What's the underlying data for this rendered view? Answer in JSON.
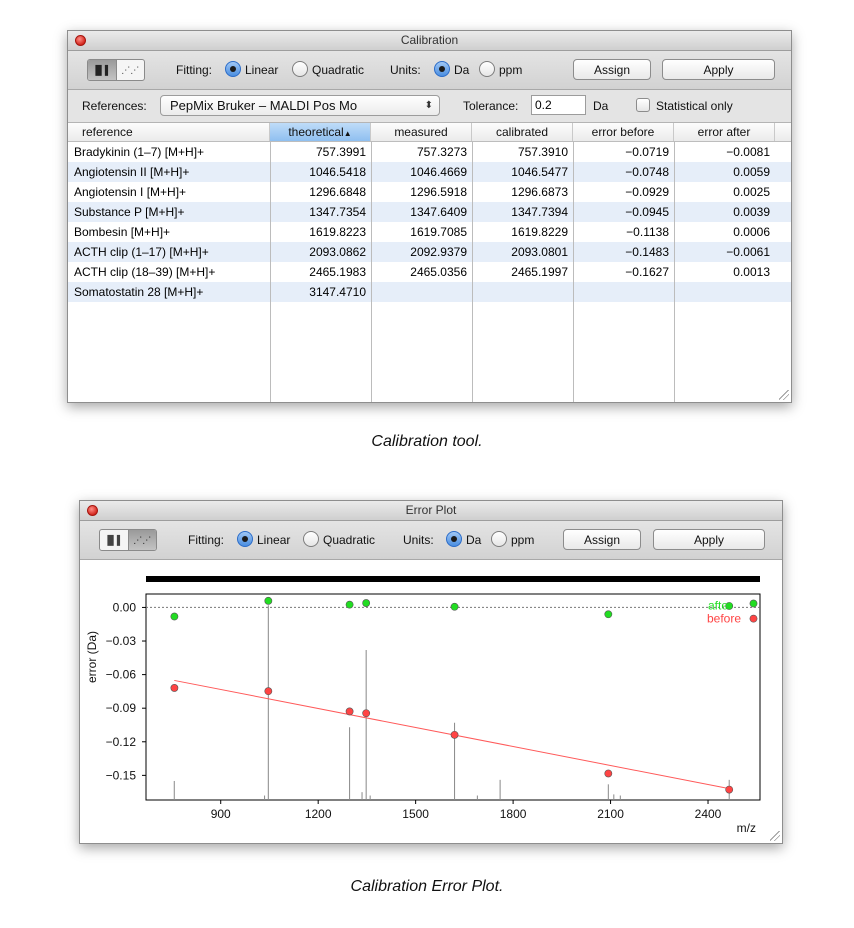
{
  "calibration_window": {
    "title": "Calibration",
    "toolbar": {
      "fitting_label": "Fitting:",
      "fitting_options": [
        "Linear",
        "Quadratic"
      ],
      "fitting_selected": "Linear",
      "units_label": "Units:",
      "units_options": [
        "Da",
        "ppm"
      ],
      "units_selected": "Da",
      "assign_label": "Assign",
      "apply_label": "Apply"
    },
    "references_bar": {
      "references_label": "References:",
      "references_value": "PepMix Bruker – MALDI Pos Mo",
      "tolerance_label": "Tolerance:",
      "tolerance_value": "0.2",
      "tolerance_unit": "Da",
      "statistical_only_label": "Statistical only"
    },
    "table": {
      "columns": [
        "reference",
        "theoretical",
        "measured",
        "calibrated",
        "error before",
        "error after"
      ],
      "sorted_column": "theoretical",
      "rows": [
        [
          "Bradykinin (1–7) [M+H]+",
          "757.3991",
          "757.3273",
          "757.3910",
          "−0.0719",
          "−0.0081"
        ],
        [
          "Angiotensin II [M+H]+",
          "1046.5418",
          "1046.4669",
          "1046.5477",
          "−0.0748",
          "0.0059"
        ],
        [
          "Angiotensin I [M+H]+",
          "1296.6848",
          "1296.5918",
          "1296.6873",
          "−0.0929",
          "0.0025"
        ],
        [
          "Substance P [M+H]+",
          "1347.7354",
          "1347.6409",
          "1347.7394",
          "−0.0945",
          "0.0039"
        ],
        [
          "Bombesin [M+H]+",
          "1619.8223",
          "1619.7085",
          "1619.8229",
          "−0.1138",
          "0.0006"
        ],
        [
          "ACTH clip (1–17) [M+H]+",
          "2093.0862",
          "2092.9379",
          "2093.0801",
          "−0.1483",
          "−0.0061"
        ],
        [
          "ACTH clip (18–39) [M+H]+",
          "2465.1983",
          "2465.0356",
          "2465.1997",
          "−0.1627",
          "0.0013"
        ],
        [
          "Somatostatin 28 [M+H]+",
          "3147.4710",
          "",
          "",
          "",
          ""
        ]
      ]
    }
  },
  "caption_1": "Calibration tool.",
  "error_plot_window": {
    "title": "Error Plot",
    "toolbar": {
      "fitting_label": "Fitting:",
      "fitting_options": [
        "Linear",
        "Quadratic"
      ],
      "fitting_selected": "Linear",
      "units_label": "Units:",
      "units_options": [
        "Da",
        "ppm"
      ],
      "units_selected": "Da",
      "assign_label": "Assign",
      "apply_label": "Apply"
    }
  },
  "caption_2": "Calibration Error Plot.",
  "colors": {
    "before": "#ff4444",
    "after": "#22dd22",
    "fit_line": "#ff5a5a",
    "spectrum": "#888888"
  },
  "chart_data": {
    "type": "scatter",
    "xlabel": "m/z",
    "ylabel": "error (Da)",
    "xlim": [
      670,
      2560
    ],
    "ylim": [
      -0.172,
      0.012
    ],
    "x_ticks": [
      900,
      1200,
      1500,
      1800,
      2100,
      2400
    ],
    "y_ticks": [
      0.0,
      -0.03,
      -0.06,
      -0.09,
      -0.12,
      -0.15
    ],
    "y_tick_labels": [
      "0.00",
      "−0.03",
      "−0.06",
      "−0.09",
      "−0.12",
      "−0.15"
    ],
    "legend": [
      "after",
      "before"
    ],
    "legend_position": "top-right",
    "series": [
      {
        "name": "after",
        "color": "#22dd22",
        "x": [
          757.3991,
          1046.5418,
          1296.6848,
          1347.7354,
          1619.8223,
          2093.0862,
          2465.1983,
          2540
        ],
        "y": [
          -0.0081,
          0.0059,
          0.0025,
          0.0039,
          0.0006,
          -0.0061,
          0.0013,
          0.0035
        ]
      },
      {
        "name": "before",
        "color": "#ff4444",
        "x": [
          757.3991,
          1046.5418,
          1296.6848,
          1347.7354,
          1619.8223,
          2093.0862,
          2465.1983,
          2540
        ],
        "y": [
          -0.0719,
          -0.0748,
          -0.0929,
          -0.0945,
          -0.1138,
          -0.1483,
          -0.1627,
          -0.01
        ]
      }
    ],
    "fit_line": {
      "x": [
        757,
        2475
      ],
      "y": [
        -0.0652,
        -0.1624
      ]
    },
    "spectrum_peaks": [
      {
        "x": 757,
        "y": -0.155
      },
      {
        "x": 1035,
        "y": -0.168
      },
      {
        "x": 1046.5,
        "y": 0.002
      },
      {
        "x": 1296.7,
        "y": -0.107
      },
      {
        "x": 1335,
        "y": -0.165
      },
      {
        "x": 1347.7,
        "y": -0.038
      },
      {
        "x": 1360,
        "y": -0.168
      },
      {
        "x": 1619.8,
        "y": -0.103
      },
      {
        "x": 1690,
        "y": -0.168
      },
      {
        "x": 1760,
        "y": -0.154
      },
      {
        "x": 2093.1,
        "y": -0.158
      },
      {
        "x": 2110,
        "y": -0.167
      },
      {
        "x": 2130,
        "y": -0.168
      },
      {
        "x": 2465.2,
        "y": -0.154
      }
    ]
  }
}
